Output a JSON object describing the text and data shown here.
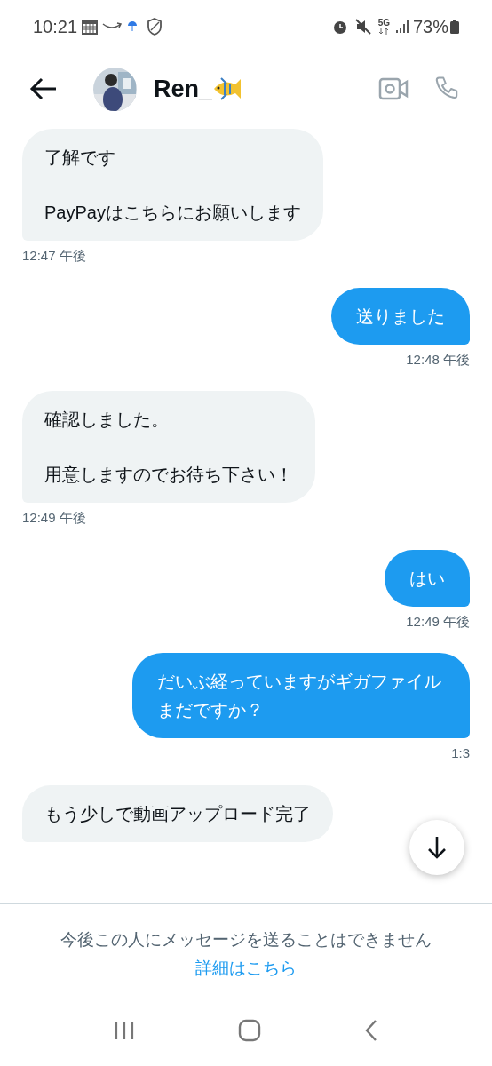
{
  "status_bar": {
    "time": "10:21",
    "network": "5G",
    "battery": "73%"
  },
  "header": {
    "name": "Ren_"
  },
  "messages": [
    {
      "kind": "received",
      "paragraphs": [
        "了解です",
        "PayPayはこちらにお願いします"
      ],
      "time": "12:47 午後"
    },
    {
      "kind": "sent",
      "paragraphs": [
        "送りました"
      ],
      "time": "12:48 午後"
    },
    {
      "kind": "received",
      "paragraphs": [
        "確認しました。",
        "用意しますのでお待ち下さい！"
      ],
      "time": "12:49 午後"
    },
    {
      "kind": "sent",
      "paragraphs": [
        "はい"
      ],
      "time": "12:49 午後"
    },
    {
      "kind": "sent",
      "paragraphs": [
        "だいぶ経っていますがギガファイルまだですか？"
      ],
      "time": "1:3"
    },
    {
      "kind": "received",
      "paragraphs": [
        "もう少しで動画アップロード完了"
      ]
    }
  ],
  "notice": {
    "text": "今後この人にメッセージを送ることはできません",
    "link": "詳細はこちら"
  }
}
